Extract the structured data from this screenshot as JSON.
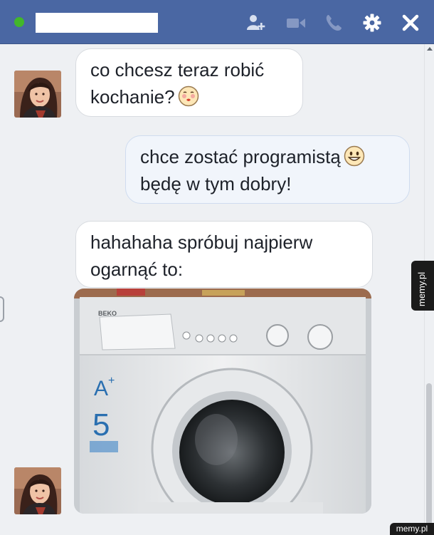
{
  "header": {
    "contact_name": "",
    "icons": [
      "add-friend-icon",
      "video-call-icon",
      "phone-icon",
      "gear-icon",
      "close-icon"
    ],
    "bg_color": "#4a67a3",
    "online_color": "#42b72a"
  },
  "messages": [
    {
      "side": "in",
      "line1": "co chcesz teraz robić",
      "line2": "kochanie?",
      "emoji": "kiss-face"
    },
    {
      "side": "out",
      "line1": "chce zostać programistą",
      "line2": "będę w tym dobry!",
      "emoji": "smiley-face"
    },
    {
      "side": "in",
      "line1": "hahahaha spróbuj najpierw",
      "line2": "ogarnąć to:",
      "emoji": ""
    }
  ],
  "photo": {
    "brand": "BEKO",
    "energy_class": "A",
    "energy_plus": "+",
    "load_kg": "5"
  },
  "watermark": {
    "side": "memy.pl",
    "bottom": "memy.pl"
  }
}
